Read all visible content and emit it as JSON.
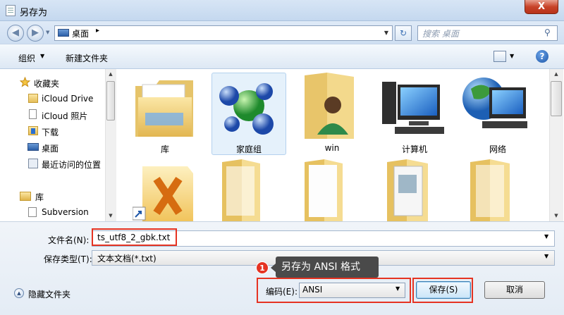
{
  "window": {
    "title": "另存为",
    "close_label": "X"
  },
  "nav": {
    "back_label": "◀",
    "forward_label": "▶",
    "address": "桌面",
    "address_sep": "▸",
    "search_placeholder": "搜索 桌面"
  },
  "toolbar": {
    "organize_label": "组织",
    "new_folder_label": "新建文件夹"
  },
  "sidebar": {
    "items": [
      {
        "label": "收藏夹",
        "icon": "star-icon"
      },
      {
        "label": "iCloud Drive",
        "icon": "folder-icon"
      },
      {
        "label": "iCloud 照片",
        "icon": "document-icon"
      },
      {
        "label": "下载",
        "icon": "download-folder-icon"
      },
      {
        "label": "桌面",
        "icon": "desktop-icon"
      },
      {
        "label": "最近访问的位置",
        "icon": "recent-places-icon"
      },
      {
        "label": "库",
        "icon": "library-icon"
      },
      {
        "label": "Subversion",
        "icon": "subversion-icon"
      }
    ]
  },
  "content": {
    "tiles": [
      {
        "label": "库",
        "icon": "library-folder-icon"
      },
      {
        "label": "家庭组",
        "icon": "homegroup-icon"
      },
      {
        "label": "win",
        "icon": "user-folder-icon"
      },
      {
        "label": "计算机",
        "icon": "computer-icon"
      },
      {
        "label": "网络",
        "icon": "network-icon"
      },
      {
        "label": "",
        "icon": "xmind-shortcut-icon"
      },
      {
        "label": "",
        "icon": "folder-icon"
      },
      {
        "label": "",
        "icon": "folder-icon"
      },
      {
        "label": "",
        "icon": "folder-icon"
      },
      {
        "label": "",
        "icon": "folder-icon"
      }
    ]
  },
  "form": {
    "filename_label": "文件名(N):",
    "filename_value": "ts_utf8_2_gbk.txt",
    "filetype_label": "保存类型(T):",
    "filetype_value": "文本文档(*.txt)",
    "encoding_label": "编码(E):",
    "encoding_value": "ANSI",
    "hide_folders_label": "隐藏文件夹",
    "save_label": "保存(S)",
    "cancel_label": "取消"
  },
  "annotation": {
    "number": "1",
    "text": "另存为 ANSI 格式"
  },
  "colors": {
    "highlight": "#e53322",
    "callout_bg": "#4a4a4a"
  }
}
